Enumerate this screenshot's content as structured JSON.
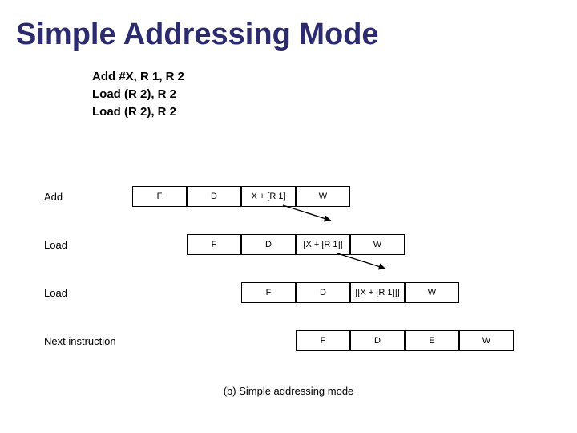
{
  "title": "Simple Addressing Mode",
  "code": {
    "line1": "Add  #X, R 1, R 2",
    "line2": "Load  (R 2), R 2",
    "line3": "Load  (R 2), R 2"
  },
  "rows": {
    "r0": {
      "label": "Add",
      "c0": "F",
      "c1": "D",
      "c2": "X + [R 1]",
      "c3": "W"
    },
    "r1": {
      "label": "Load",
      "c0": "F",
      "c1": "D",
      "c2": "[X + [R 1]]",
      "c3": "W"
    },
    "r2": {
      "label": "Load",
      "c0": "F",
      "c1": "D",
      "c2": "[[X + [R 1]]]",
      "c3": "W"
    },
    "r3": {
      "label": "Next instruction",
      "c0": "F",
      "c1": "D",
      "c2": "E",
      "c3": "W"
    }
  },
  "caption": "(b) Simple addressing mode"
}
